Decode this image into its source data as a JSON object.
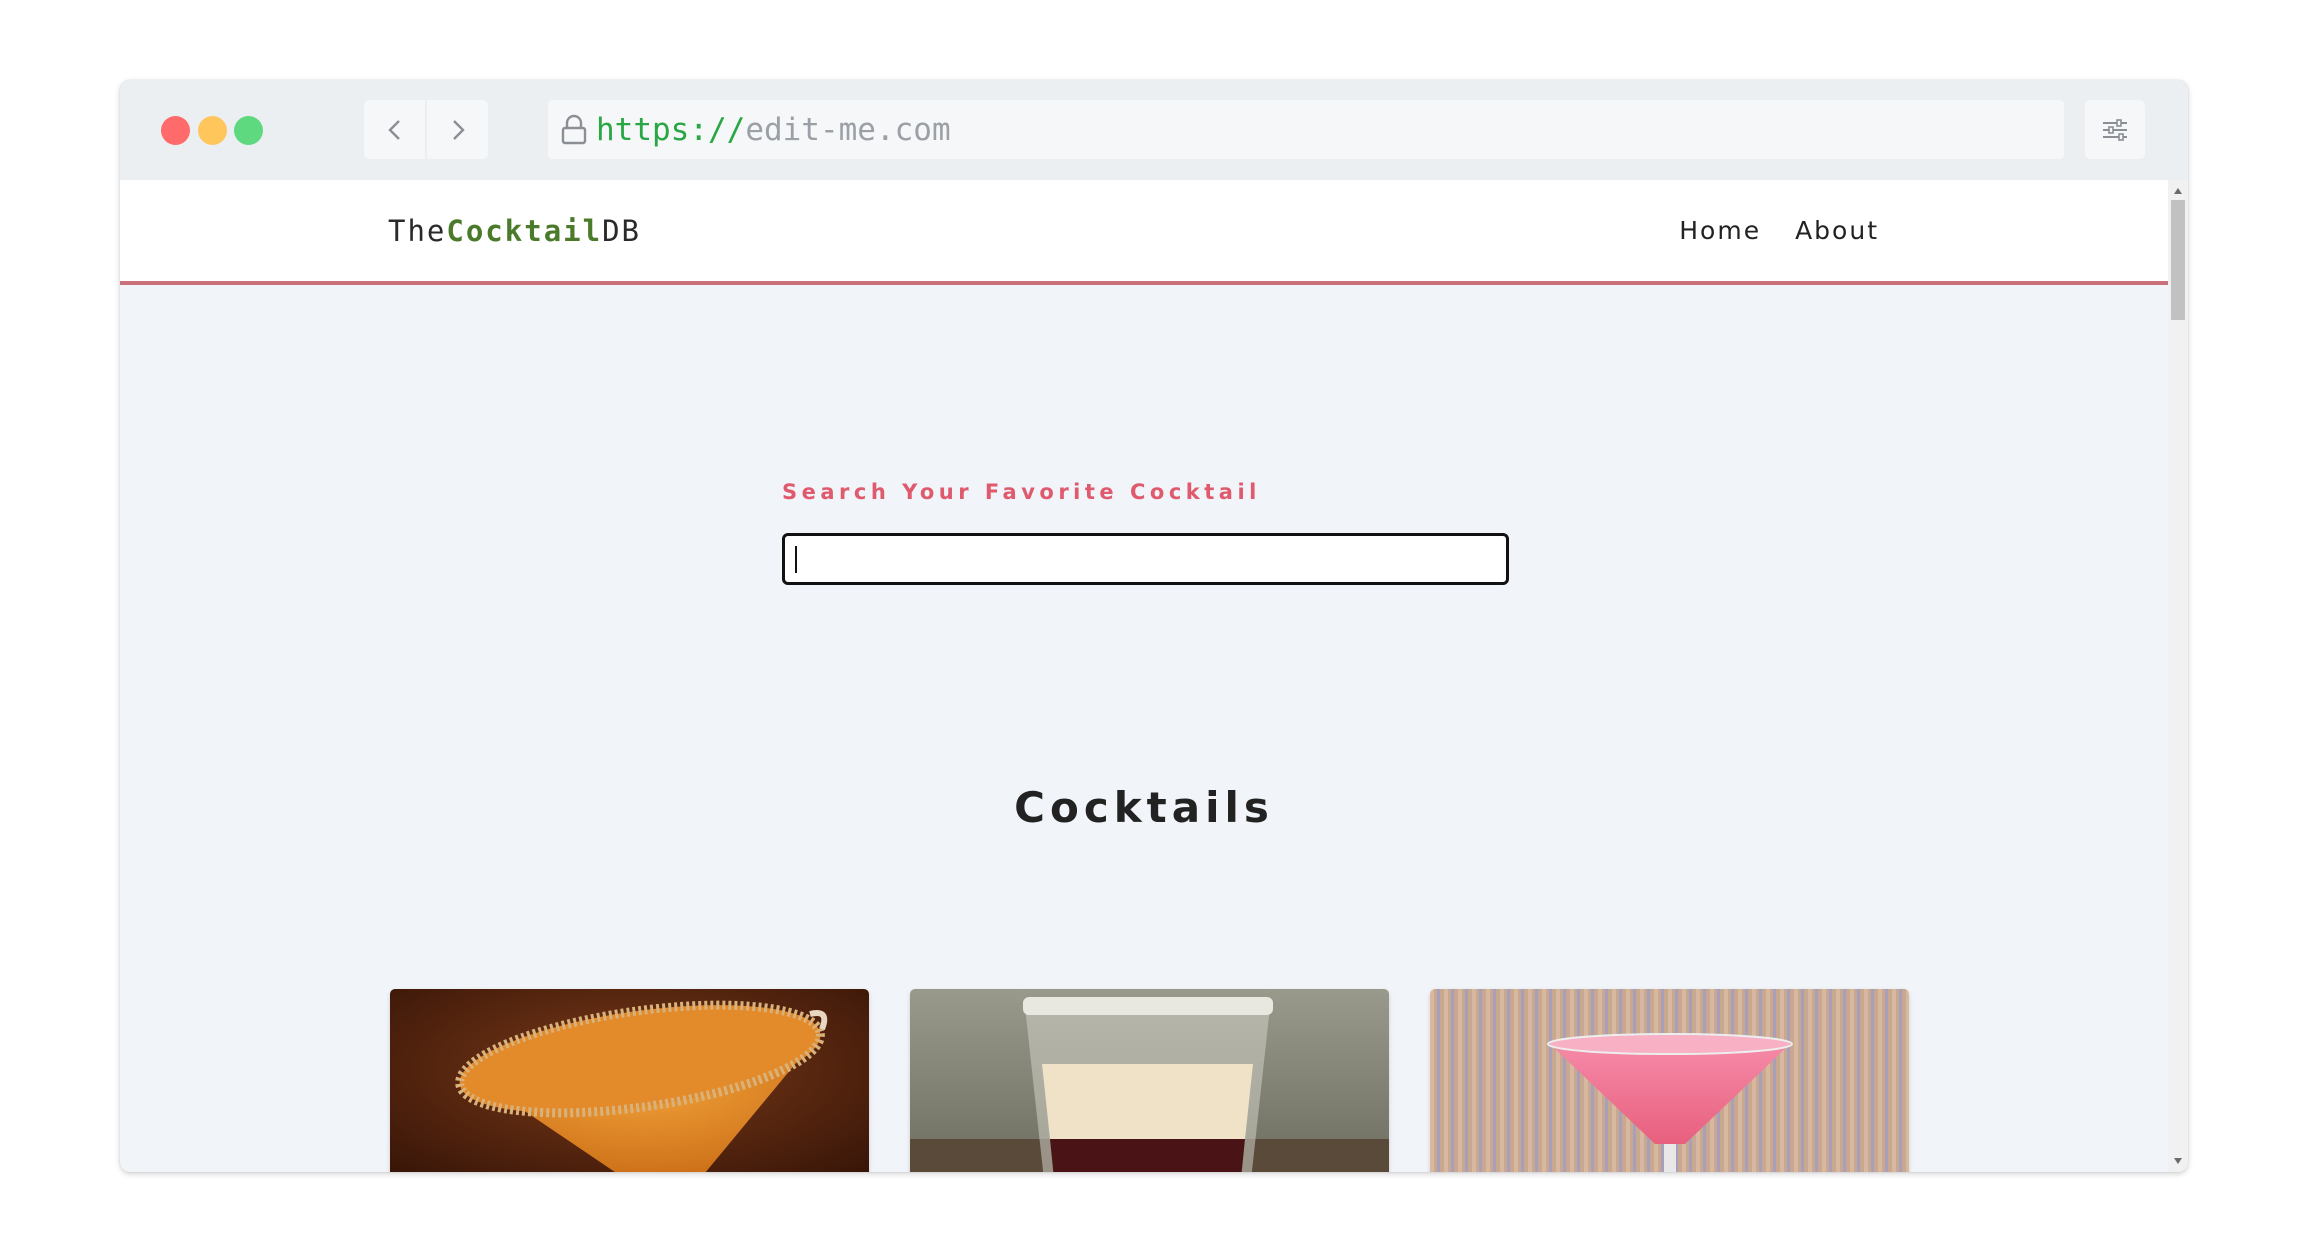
{
  "browser": {
    "url_scheme": "https://",
    "url_host": "edit-me.com"
  },
  "site": {
    "logo_prefix": "The",
    "logo_brand": "Cocktail",
    "logo_suffix": "DB",
    "nav": [
      {
        "label": "Home"
      },
      {
        "label": "About"
      }
    ]
  },
  "search": {
    "label": "Search Your Favorite Cocktail",
    "value": ""
  },
  "main": {
    "section_title": "Cocktails"
  },
  "colors": {
    "accent": "#e05a6e",
    "brand_green": "#4a7a2a",
    "nav_border": "#c9707b",
    "url_scheme": "#29a745"
  },
  "icons": [
    "lock-icon",
    "chevron-left-icon",
    "chevron-right-icon",
    "settings-sliders-icon"
  ]
}
